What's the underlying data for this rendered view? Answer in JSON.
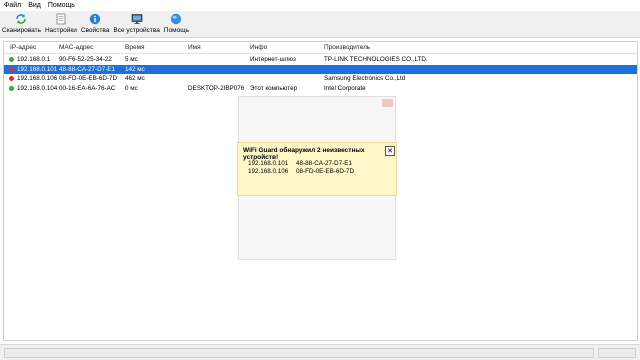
{
  "menu": {
    "file": "Файл",
    "view": "Вид",
    "help": "Помощь"
  },
  "toolbar": {
    "scan": "Сканировать",
    "settings": "Настройки",
    "properties": "Свойства",
    "all_devices": "Все устройства",
    "help": "Помощь"
  },
  "table": {
    "headers": [
      "IP-адрес",
      "MAC-адрес",
      "Время",
      "Имя",
      "Инфо",
      "Производитель"
    ],
    "rows": [
      {
        "ip": "192.168.0.1",
        "mac": "90-F6-52-25-34-22",
        "time": "5 мс",
        "name": "",
        "info": "Интернет-шлюз",
        "vendor": "TP-LINK TECHNOLOGIES CO.,LTD.",
        "status": "green"
      },
      {
        "ip": "192.168.0.101",
        "mac": "48-88-CA-27-D7-E1",
        "time": "142 мс",
        "name": "",
        "info": "",
        "vendor": "",
        "status": "red"
      },
      {
        "ip": "192.168.0.106",
        "mac": "08-FD-0E-EB-6D-7D",
        "time": "462 мс",
        "name": "",
        "info": "",
        "vendor": "Samsung Electronics Co.,Ltd",
        "status": "red"
      },
      {
        "ip": "192.168.0.104",
        "mac": "00-16-EA-6A-76-AC",
        "time": "0 мс",
        "name": "DESKTOP-2IBP076",
        "info": "Этот компьютер",
        "vendor": "Intel Corporate",
        "status": "green"
      }
    ]
  },
  "popup": {
    "title": "WiFi Guard обнаружил 2 неизвестных устройств!",
    "close": "✕",
    "devices": [
      {
        "ip": "192.168.0.101",
        "mac": "48-88-CA-27-D7-E1"
      },
      {
        "ip": "192.168.0.106",
        "mac": "08-FD-0E-EB-6D-7D"
      }
    ]
  },
  "colors": {
    "selection": "#1c6fdc",
    "status_green": "#3aa832",
    "status_red": "#d9342b",
    "popup_bg": "#fdf6c6"
  },
  "icons": {
    "scan": "refresh-icon",
    "settings": "settings-page-icon",
    "properties": "info-icon",
    "all_devices": "monitor-icon",
    "help": "help-globe-icon"
  }
}
